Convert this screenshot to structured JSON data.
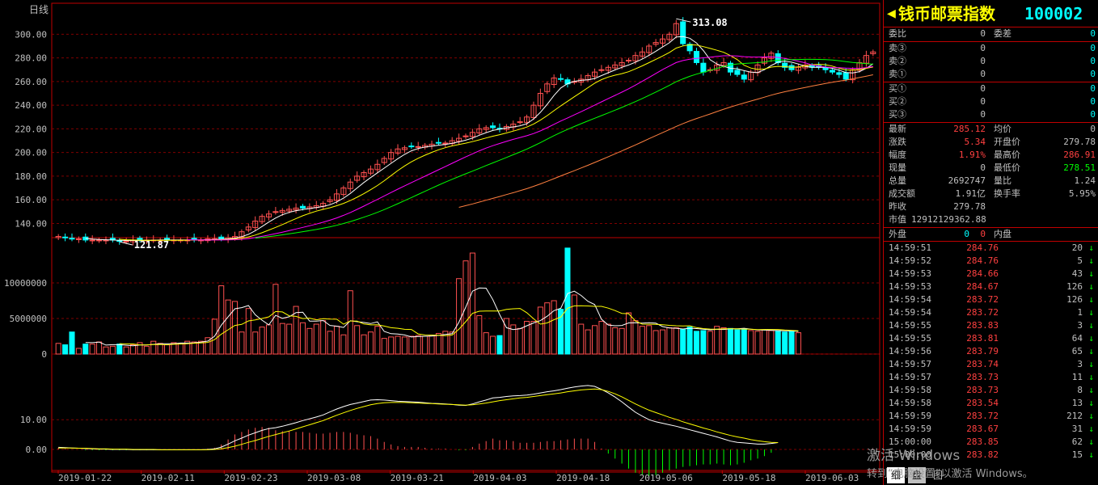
{
  "chart": {
    "period_label": "日线",
    "high_label": "313.08",
    "low_label": "121.87",
    "y_ticks": [
      "300.00",
      "280.00",
      "260.00",
      "240.00",
      "220.00",
      "200.00",
      "180.00",
      "160.00",
      "140.00"
    ],
    "vol_ticks": [
      "10000000",
      "5000000",
      "0"
    ],
    "macd_ticks": [
      "10.00",
      "0.00"
    ],
    "dates": [
      "2019-01-22",
      "2019-02-11",
      "2019-02-23",
      "2019-03-08",
      "2019-03-21",
      "2019-04-03",
      "2019-04-18",
      "2019-05-06",
      "2019-05-18",
      "2019-06-03"
    ],
    "colors": {
      "up": "#ff5050",
      "down": "#00ffff",
      "grid": "#800000",
      "axis": "#c00000",
      "ma5": "#ffffff",
      "ma10": "#ffff00",
      "ma20": "#ff00ff",
      "ma30": "#00ff00",
      "ma60": "#ff8040"
    }
  },
  "chart_data": {
    "type": "candlestick",
    "price_ylim": [
      128,
      318
    ],
    "closes": [
      129,
      128,
      127,
      127,
      126,
      126,
      126,
      126,
      126,
      125,
      125,
      126,
      126,
      126,
      126,
      126,
      126,
      126,
      126,
      126,
      126,
      126,
      127,
      127,
      127,
      128,
      129,
      133,
      137,
      142,
      146,
      148,
      150,
      151,
      152,
      153,
      153,
      154,
      155,
      157,
      160,
      165,
      170,
      175,
      180,
      183,
      186,
      190,
      195,
      200,
      203,
      204,
      205,
      205,
      206,
      207,
      208,
      208,
      210,
      212,
      214,
      217,
      220,
      221,
      221,
      220,
      222,
      224,
      226,
      230,
      240,
      250,
      258,
      263,
      262,
      258,
      260,
      262,
      265,
      268,
      270,
      272,
      274,
      276,
      278,
      282,
      285,
      290,
      293,
      296,
      300,
      309,
      292,
      286,
      276,
      268,
      270,
      274,
      276,
      268,
      266,
      262,
      268,
      274,
      280,
      284,
      276,
      272,
      270,
      272,
      274,
      272,
      272,
      270,
      268,
      266,
      262,
      270,
      276,
      282,
      285
    ],
    "volumes": [
      1.5,
      1.3,
      3.1,
      0.8,
      1.4,
      1.4,
      1.7,
      1.0,
      1.1,
      1.4,
      1.0,
      1.3,
      1.6,
      1.1,
      1.8,
      1.5,
      1.3,
      1.6,
      1.5,
      1.8,
      1.7,
      1.8,
      2.3,
      4.9,
      9.6,
      7.6,
      7.4,
      3.1,
      6.4,
      3.1,
      3.8,
      4.1,
      9.8,
      4.3,
      4.2,
      6.7,
      4.4,
      3.6,
      4.2,
      4.7,
      3.2,
      3.9,
      2.7,
      8.9,
      4.0,
      2.7,
      3.1,
      3.9,
      2.2,
      2.4,
      2.5,
      2.4,
      2.5,
      2.6,
      2.5,
      2.6,
      2.9,
      3.2,
      3.1,
      10.6,
      13.1,
      14.2,
      5.4,
      3.0,
      2.5,
      2.6,
      5.0,
      4.1,
      3.6,
      4.6,
      4.6,
      6.6,
      7.2,
      7.5,
      6.3,
      14.9,
      8.3,
      4.2,
      3.4,
      4.0,
      4.6,
      4.2,
      3.7,
      3.6,
      5.8,
      4.7,
      3.9,
      4.0,
      3.3,
      3.4,
      3.7,
      3.7,
      3.5,
      3.8,
      3.2,
      3.3,
      3.2,
      3.9,
      3.7,
      3.6,
      3.4,
      3.5,
      3.3,
      3.2,
      3.4,
      3.3,
      3.3,
      3.1,
      3.2,
      3.0
    ],
    "volume_unit": "millions",
    "volume_ylim": [
      0,
      15
    ],
    "macd_ylim": [
      -5,
      25
    ],
    "dif": [
      0.7,
      0.6,
      0.5,
      0.4,
      0.3,
      0.2,
      0.1,
      0.1,
      0.0,
      0.0,
      0.0,
      -0.1,
      -0.1,
      -0.1,
      -0.1,
      -0.1,
      -0.1,
      -0.1,
      -0.1,
      -0.1,
      -0.1,
      -0.1,
      0.0,
      0.2,
      0.8,
      1.8,
      2.9,
      3.8,
      4.8,
      5.6,
      6.4,
      7.0,
      7.3,
      7.8,
      8.4,
      9.0,
      9.7,
      10.3,
      10.9,
      11.6,
      12.6,
      13.6,
      14.4,
      15.1,
      15.6,
      16.1,
      16.6,
      16.7,
      16.6,
      16.4,
      16.2,
      16.1,
      16.0,
      15.9,
      15.7,
      15.5,
      15.4,
      15.3,
      15.1,
      14.9,
      14.8,
      15.3,
      16.0,
      16.6,
      17.3,
      17.5,
      17.8,
      18.0,
      18.1,
      18.3,
      18.6,
      19.0,
      19.4,
      19.7,
      20.1,
      20.6,
      21.0,
      21.3,
      21.5,
      21.2,
      20.2,
      19.0,
      17.6,
      16.0,
      14.2,
      12.5,
      11.2,
      10.0,
      9.3,
      8.8,
      8.3,
      7.8,
      7.2,
      6.6,
      6.0,
      5.4,
      4.8,
      4.2,
      3.5,
      2.8,
      2.4,
      2.2,
      2.0,
      1.8,
      1.8,
      2.0,
      2.3
    ],
    "dea": [
      0.5,
      0.5,
      0.5,
      0.4,
      0.4,
      0.3,
      0.2,
      0.2,
      0.1,
      0.1,
      0.1,
      0.0,
      0.0,
      0.0,
      0.0,
      -0.1,
      -0.1,
      -0.1,
      -0.1,
      -0.1,
      -0.1,
      -0.1,
      -0.1,
      0.0,
      0.2,
      0.6,
      1.1,
      1.7,
      2.4,
      3.0,
      3.7,
      4.4,
      5.0,
      5.6,
      6.2,
      6.9,
      7.6,
      8.3,
      9.0,
      9.7,
      10.6,
      11.5,
      12.3,
      13.1,
      13.8,
      14.4,
      15.0,
      15.4,
      15.7,
      15.8,
      15.8,
      15.8,
      15.7,
      15.6,
      15.5,
      15.4,
      15.3,
      15.2,
      15.1,
      15.0,
      14.9,
      15.0,
      15.3,
      15.6,
      16.0,
      16.4,
      16.7,
      17.0,
      17.3,
      17.5,
      17.8,
      18.1,
      18.4,
      18.7,
      19.0,
      19.4,
      19.7,
      20.0,
      20.2,
      20.3,
      20.1,
      19.5,
      18.7,
      17.7,
      16.5,
      15.3,
      14.2,
      13.2,
      12.4,
      11.6,
      10.8,
      10.1,
      9.3,
      8.6,
      7.9,
      7.2,
      6.6,
      5.9,
      5.3,
      4.7,
      4.2,
      3.8,
      3.3,
      2.9,
      2.6,
      2.4,
      2.3
    ]
  },
  "panel": {
    "name": "钱币邮票指数",
    "code": "100002",
    "wb": {
      "l1": "委比",
      "v1": "0",
      "l2": "委差",
      "v2": "0"
    },
    "sells": [
      {
        "l": "卖③",
        "p": "0",
        "q": "0"
      },
      {
        "l": "卖②",
        "p": "0",
        "q": "0"
      },
      {
        "l": "卖①",
        "p": "0",
        "q": "0"
      }
    ],
    "buys": [
      {
        "l": "买①",
        "p": "0",
        "q": "0"
      },
      {
        "l": "买②",
        "p": "0",
        "q": "0"
      },
      {
        "l": "买③",
        "p": "0",
        "q": "0"
      }
    ],
    "stats": [
      {
        "l1": "最新",
        "v1": "285.12",
        "c1": "#ff4040",
        "l2": "均价",
        "v2": "0",
        "c2": "#c0c0c0"
      },
      {
        "l1": "涨跌",
        "v1": "5.34",
        "c1": "#ff4040",
        "l2": "开盘价",
        "v2": "279.78",
        "c2": "#c0c0c0"
      },
      {
        "l1": "幅度",
        "v1": "1.91%",
        "c1": "#ff4040",
        "l2": "最高价",
        "v2": "286.91",
        "c2": "#ff4040"
      },
      {
        "l1": "现量",
        "v1": "0",
        "c1": "#c0c0c0",
        "l2": "最低价",
        "v2": "278.51",
        "c2": "#00ff00"
      },
      {
        "l1": "总量",
        "v1": "2692747",
        "c1": "#c0c0c0",
        "l2": "量比",
        "v2": "1.24",
        "c2": "#c0c0c0"
      },
      {
        "l1": "成交额",
        "v1": "1.91亿",
        "c1": "#c0c0c0",
        "l2": "换手率",
        "v2": "5.95%",
        "c2": "#c0c0c0"
      }
    ],
    "prev_close": {
      "l": "昨收",
      "v": "279.78"
    },
    "mkt_value": {
      "l": "市值",
      "v": "12912129362.88"
    },
    "outer": {
      "l1": "外盘",
      "v1": "0",
      "l2": "内盘",
      "v2": "0"
    },
    "ticks": [
      {
        "t": "14:59:51",
        "p": "284.76",
        "q": "20"
      },
      {
        "t": "14:59:52",
        "p": "284.76",
        "q": "5"
      },
      {
        "t": "14:59:53",
        "p": "284.66",
        "q": "43"
      },
      {
        "t": "14:59:53",
        "p": "284.67",
        "q": "126"
      },
      {
        "t": "14:59:54",
        "p": "283.72",
        "q": "126"
      },
      {
        "t": "14:59:54",
        "p": "283.72",
        "q": "1"
      },
      {
        "t": "14:59:55",
        "p": "283.83",
        "q": "3"
      },
      {
        "t": "14:59:55",
        "p": "283.81",
        "q": "64"
      },
      {
        "t": "14:59:56",
        "p": "283.79",
        "q": "65"
      },
      {
        "t": "14:59:57",
        "p": "283.74",
        "q": "3"
      },
      {
        "t": "14:59:57",
        "p": "283.73",
        "q": "11"
      },
      {
        "t": "14:59:58",
        "p": "283.73",
        "q": "8"
      },
      {
        "t": "14:59:58",
        "p": "283.54",
        "q": "13"
      },
      {
        "t": "14:59:59",
        "p": "283.72",
        "q": "212"
      },
      {
        "t": "14:59:59",
        "p": "283.67",
        "q": "31"
      },
      {
        "t": "15:00:00",
        "p": "283.85",
        "q": "62"
      },
      {
        "t": "15:00:00",
        "p": "283.82",
        "q": "15"
      }
    ],
    "arrow": "↓",
    "tabs": [
      "细",
      "盘",
      "图"
    ]
  },
  "watermark": {
    "line1": "激活 Windows",
    "line2": "转到“电脑设置”以激活 Windows。"
  }
}
